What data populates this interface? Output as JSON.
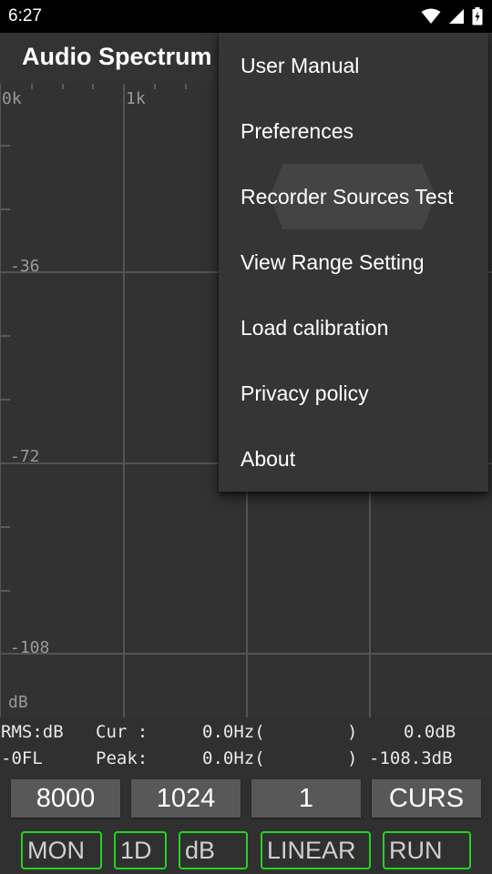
{
  "status_bar": {
    "time": "6:27",
    "icons": [
      "wifi-icon",
      "signal-icon",
      "battery-charging-icon"
    ]
  },
  "app_bar": {
    "title": "Audio Spectrum"
  },
  "plot": {
    "x_ticks": [
      "0k",
      "1k"
    ],
    "y_ticks": [
      "-36",
      "-72",
      "-108"
    ],
    "y_unit": "dB",
    "grid_color": "#555555"
  },
  "readout": {
    "row1": {
      "mode": "RMS:dB",
      "label": "Cur :",
      "freq": "0.0Hz(",
      "close": ")",
      "value": "0.0dB"
    },
    "row2": {
      "mode": "-0FL",
      "label": "Peak:",
      "freq": "0.0Hz(",
      "close": ")",
      "value": "-108.3dB"
    }
  },
  "settings_buttons": [
    "8000",
    "1024",
    "1",
    "CURS"
  ],
  "toggle_buttons": [
    "MON",
    "1D",
    "dB",
    "LINEAR",
    "RUN"
  ],
  "toggle_color": "#1fd61f",
  "overflow_menu": {
    "items": [
      "User Manual",
      "Preferences",
      "Recorder Sources Test",
      "View Range Setting",
      "Load calibration",
      "Privacy policy",
      "About"
    ],
    "pressed_item": "Recorder Sources Test"
  }
}
